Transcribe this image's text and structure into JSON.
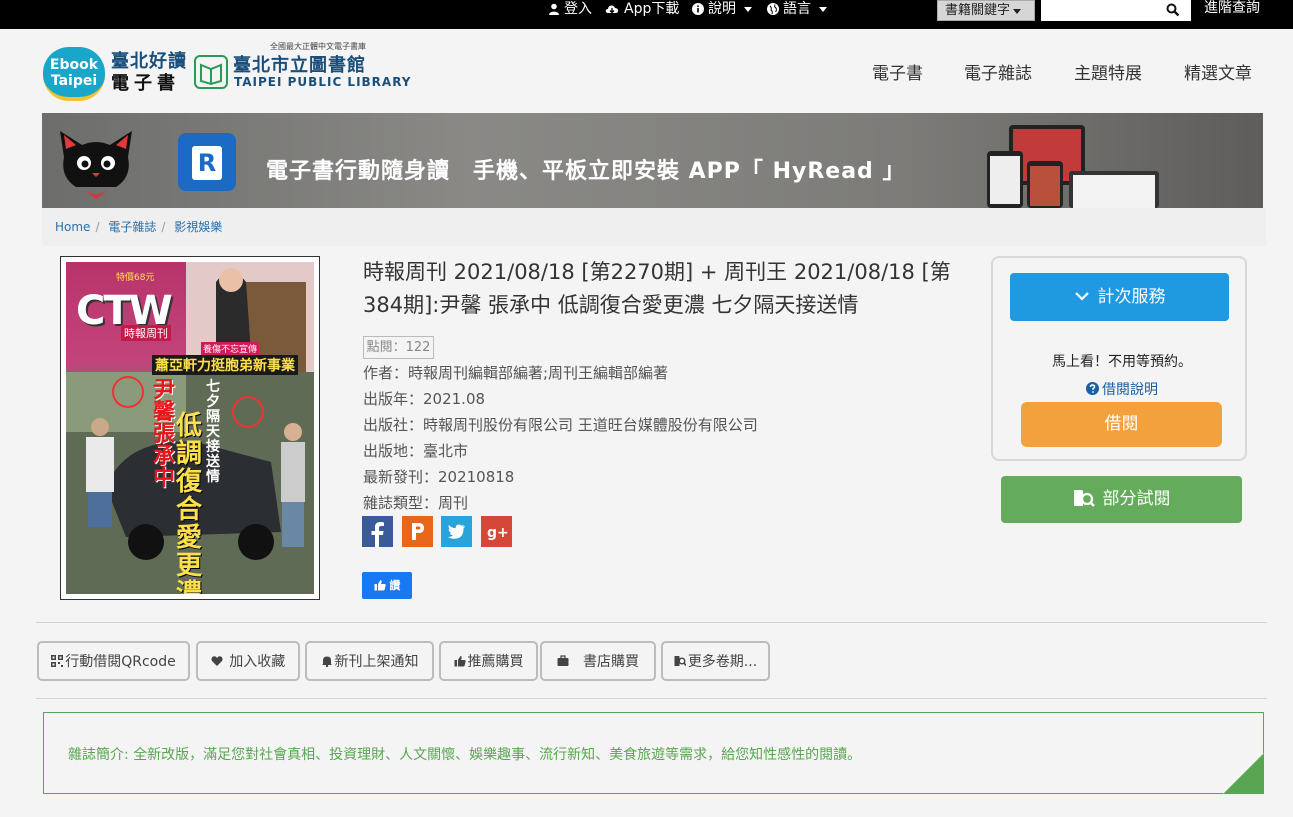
{
  "topbar": {
    "login": "登入",
    "app_download": "App下載",
    "help": "說明",
    "language": "語言",
    "search_select": "書籍關鍵字",
    "search_placeholder": "",
    "advanced_search": "進階查詢"
  },
  "header": {
    "logo_ebook_line1": "Ebook",
    "logo_ebook_line2": "Taipei",
    "logo_cn_line1": "臺北好讀",
    "logo_cn_line2": "電子書",
    "library_tagline": "全國最大正體中文電子書庫",
    "library_cn": "臺北市立圖書館",
    "library_en": "TAIPEI PUBLIC LIBRARY",
    "nav": [
      "電子書",
      "電子雜誌",
      "主題特展",
      "精選文章"
    ]
  },
  "banner": {
    "text": "電子書行動隨身讀　手機、平板立即安裝 APP「 HyRead 」",
    "app_letter": "R"
  },
  "breadcrumb": [
    "Home",
    "電子雜誌",
    "影視娛樂"
  ],
  "magazine": {
    "title": "時報周刊 2021/08/18 [第2270期] + 周刊王 2021/08/18 [第384期]:尹馨 張承中 低調復合愛更濃 七夕隔天接送情",
    "views": "點閱：122",
    "author": "作者：時報周刊編輯部編著;周刊王編輯部編著",
    "pub_year": "出版年：2021.08",
    "publisher": "出版社：時報周刊股份有限公司 王道旺台媒體股份有限公司",
    "pub_place": "出版地：臺北市",
    "latest_issue": "最新發刊：20210818",
    "mag_type": "雜誌類型：周刊",
    "fb_like": "讚"
  },
  "cover": {
    "logo": "CTW",
    "logo_sub": "時報周刊",
    "price": "特價68元",
    "headline_small": "養傷不忘宣傳",
    "headline_top": "蕭亞軒力挺胞弟新事業",
    "headline_names": "尹馨 張承中",
    "headline_side": "七夕隔天接送情",
    "headline_main": "低調復合愛更濃"
  },
  "borrow": {
    "service_button": "計次服務",
    "no_wait": "馬上看！不用等預約。",
    "help_link": "借閱說明",
    "borrow_button": "借閱",
    "preview_button": "部分試閱"
  },
  "actions": [
    "行動借閱QRcode",
    "加入收藏",
    "新刊上架通知",
    "推薦購買",
    "書店購買",
    "更多卷期..."
  ],
  "intro": "雜誌簡介: 全新改版，滿足您對社會真相、投資理財、人文關懷、娛樂趣事、流行新知、美食旅遊等需求，給您知性感性的閱讀。",
  "colors": {
    "accent_blue": "#1f9ae0",
    "borrow_orange": "#f3a13c",
    "preview_green": "#64ac5c",
    "intro_green": "#5aa552"
  }
}
